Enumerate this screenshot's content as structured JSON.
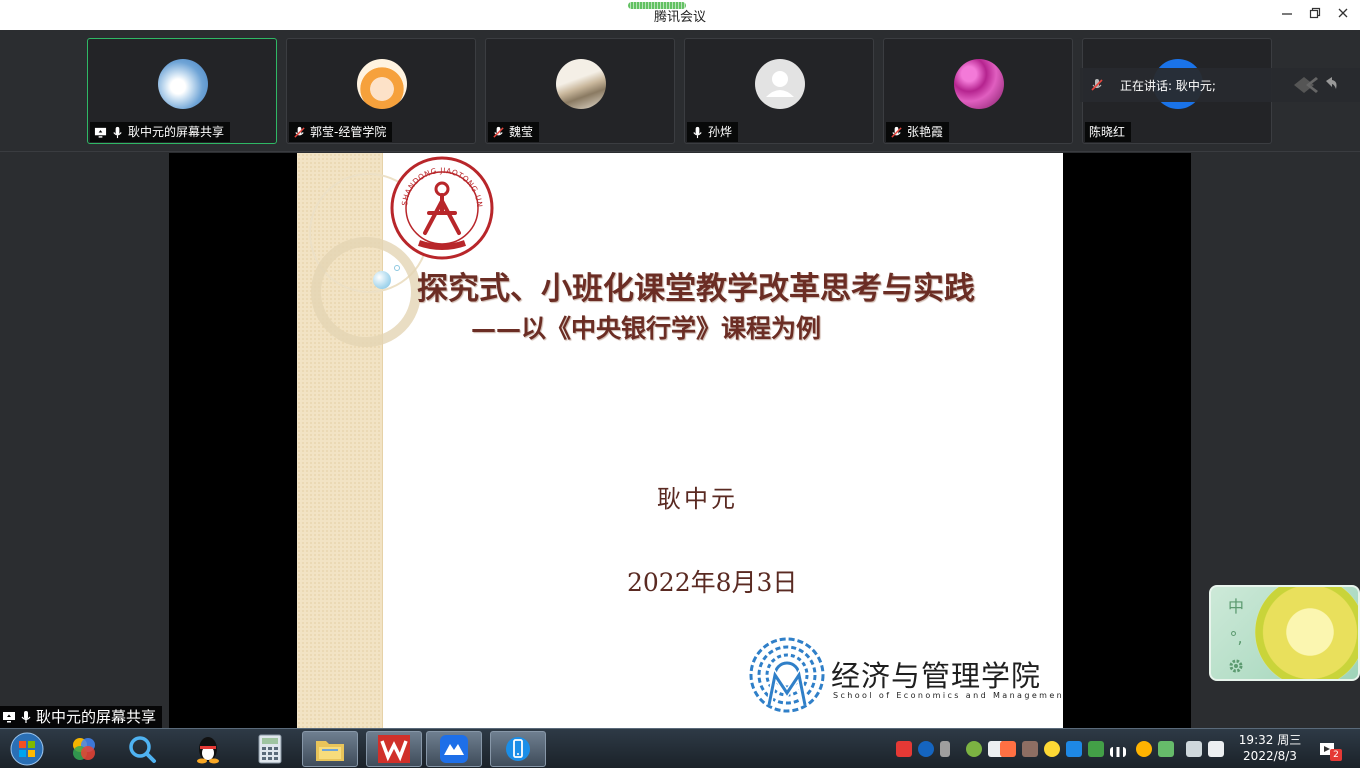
{
  "window": {
    "title": "腾讯会议",
    "minimize_icon": "minimize-icon",
    "restore_icon": "restore-icon",
    "close_icon": "close-icon"
  },
  "participants": [
    {
      "name": "耿中元的屏幕共享",
      "status_icon": "screen-share-icon",
      "mic": "mic-on-icon",
      "active": true
    },
    {
      "name": "郭莹-经管学院",
      "mic": "mic-muted-icon"
    },
    {
      "name": "魏莹",
      "mic": "mic-muted-icon"
    },
    {
      "name": "孙烨",
      "mic": "mic-on-icon"
    },
    {
      "name": "张艳霞",
      "mic": "mic-muted-icon"
    },
    {
      "name": "陈晓红"
    }
  ],
  "speaking_banner": {
    "text": "正在讲话: 耿中元;"
  },
  "slide": {
    "title": "探究式、小班化课堂教学改革思考与实践",
    "subtitle": "——以《中央银行学》课程为例",
    "author": "耿中元",
    "date": "2022年8月3日",
    "university_logo_text": "SHANDONG JIAOTONG UNIVERSITY",
    "school_name": "经济与管理学院",
    "school_name_en": "School of Economics and Management"
  },
  "share_label": {
    "text": "耿中元的屏幕共享"
  },
  "ime": {
    "lang_label": "中",
    "punct_label": "°,"
  },
  "taskbar": {
    "apps": [
      "start-orb",
      "sogou-app",
      "search-app",
      "qq-app",
      "calculator-app",
      "file-explorer-app",
      "wps-app",
      "tencent-meeting-app",
      "phone-app"
    ],
    "clock_time": "19:32 周三",
    "clock_date": "2022/8/3",
    "notification_count": "2"
  }
}
